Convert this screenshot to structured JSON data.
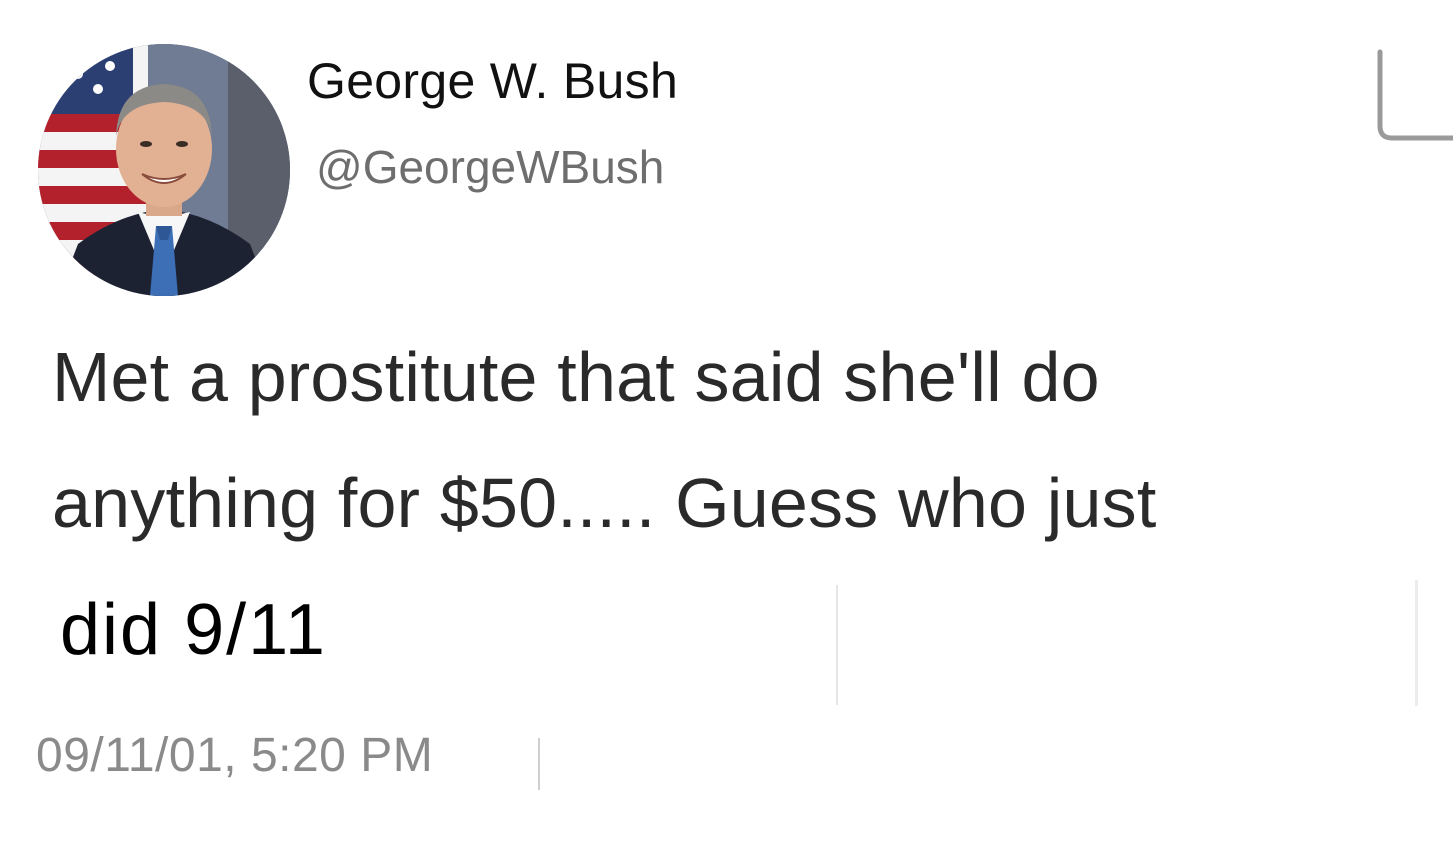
{
  "tweet": {
    "display_name": "George W. Bush",
    "handle": "@GeorgeWBush",
    "text_lines": [
      "Met a prostitute that said she'll do",
      "anything for $50..... Guess who just",
      "did 9/11"
    ],
    "timestamp": "09/11/01, 5:20 PM",
    "avatar_icon": "profile-photo",
    "corner_icon": "partial-frame-icon"
  },
  "colors": {
    "background": "#ffffff",
    "name": "#111111",
    "handle": "#6e6e6e",
    "body": "#2a2a2a",
    "timestamp": "#8a8a8a"
  }
}
